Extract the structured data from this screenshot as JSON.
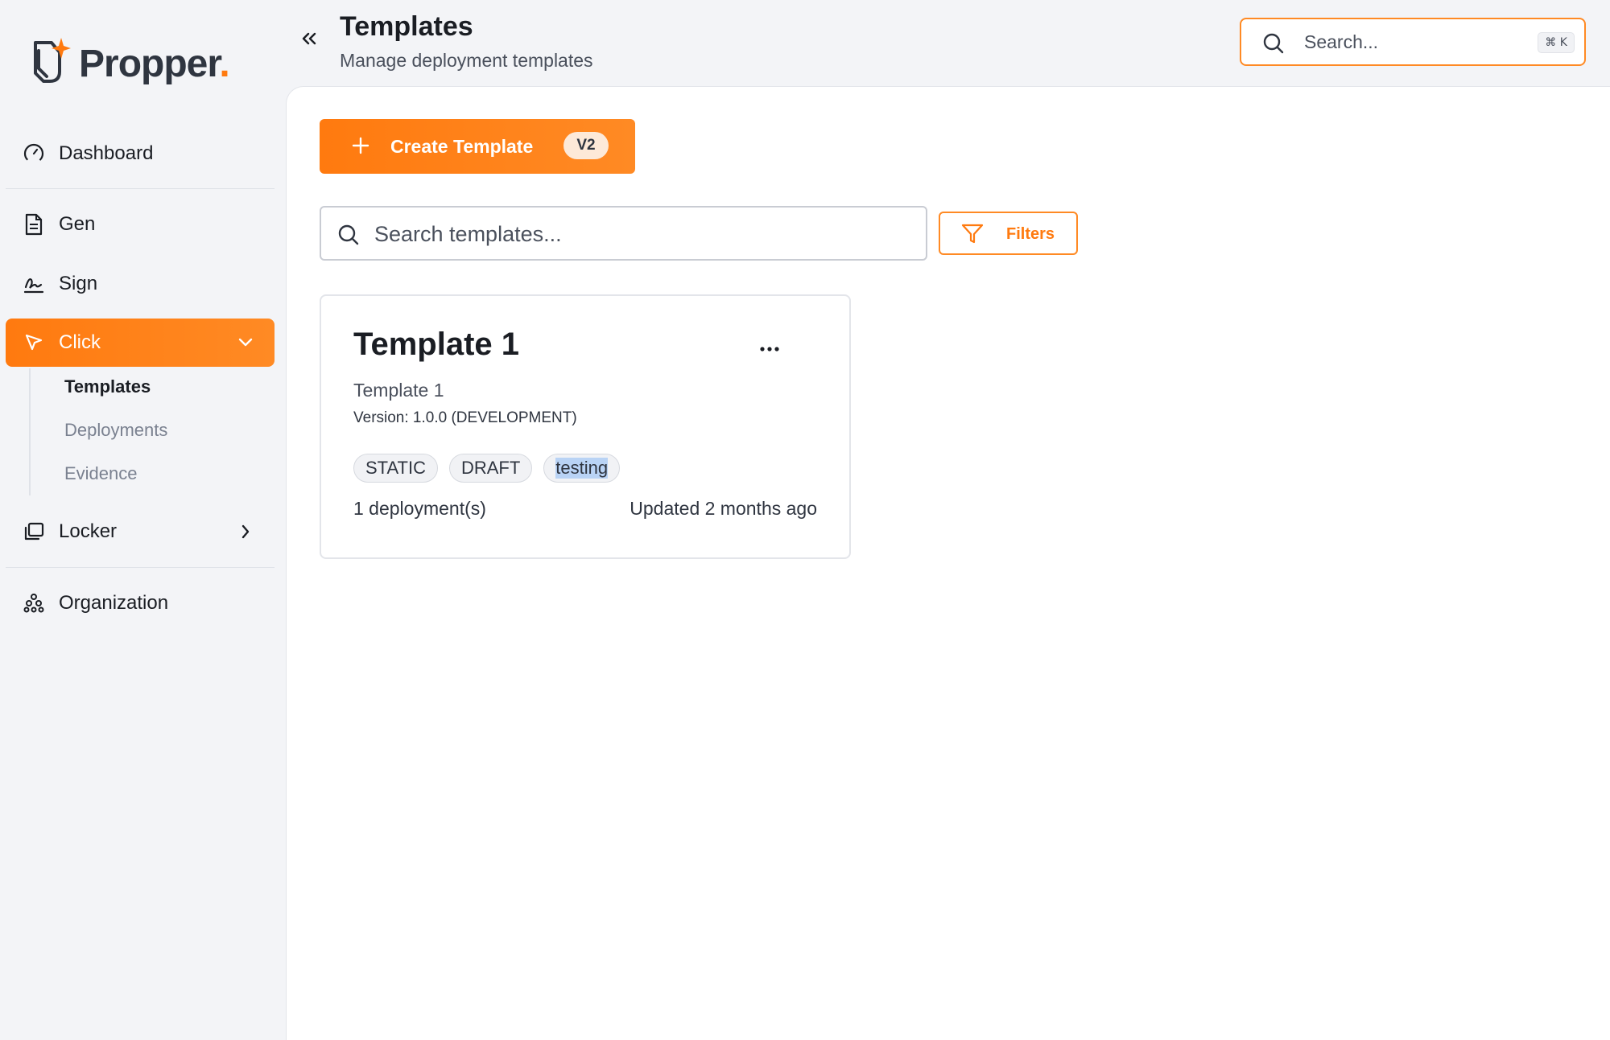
{
  "brand": {
    "name": "Propper",
    "dot": ".",
    "accent": "#ff7a0f"
  },
  "sidebar": {
    "items": [
      {
        "label": "Dashboard",
        "icon": "gauge-icon"
      },
      {
        "label": "Gen",
        "icon": "document-icon"
      },
      {
        "label": "Sign",
        "icon": "signature-icon"
      },
      {
        "label": "Click",
        "icon": "cursor-icon",
        "active": true,
        "expanded": true
      },
      {
        "label": "Locker",
        "icon": "folders-icon"
      },
      {
        "label": "Organization",
        "icon": "org-chart-icon"
      }
    ],
    "click_sub": [
      {
        "label": "Templates",
        "current": true
      },
      {
        "label": "Deployments"
      },
      {
        "label": "Evidence"
      }
    ]
  },
  "header": {
    "title": "Templates",
    "subtitle": "Manage deployment templates",
    "search_placeholder": "Search...",
    "shortcut": "⌘ K"
  },
  "toolbar": {
    "create_label": "Create Template",
    "create_badge": "V2",
    "search_placeholder": "Search templates...",
    "filters_label": "Filters"
  },
  "templates": [
    {
      "title": "Template 1",
      "name": "Template 1",
      "version": "Version: 1.0.0 (DEVELOPMENT)",
      "tags": [
        "STATIC",
        "DRAFT",
        "testing"
      ],
      "deployments": "1 deployment(s)",
      "updated": "Updated 2 months ago"
    }
  ]
}
